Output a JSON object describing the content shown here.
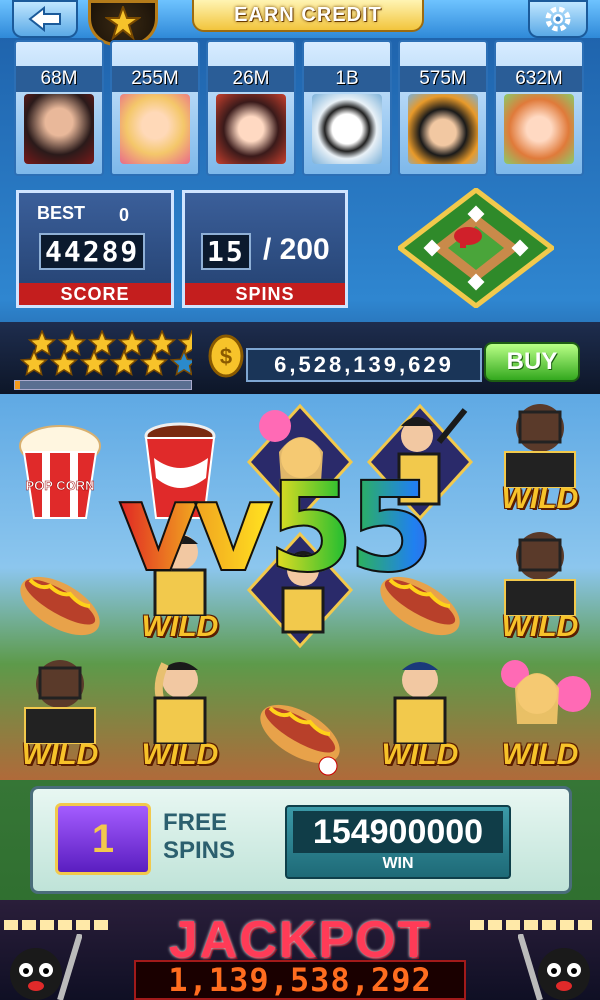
{
  "topbar": {
    "earn_credit_label": "EARN CREDIT"
  },
  "players": [
    {
      "score": "68M",
      "face_color": "#5b2a2a"
    },
    {
      "score": "255M",
      "face_color": "#f4c76a"
    },
    {
      "score": "26M",
      "face_color": "#c8402e"
    },
    {
      "score": "1B",
      "face_color": "#ffffff"
    },
    {
      "score": "575M",
      "face_color": "#e89a2a"
    },
    {
      "score": "632M",
      "face_color": "#e07a3a"
    }
  ],
  "score_panel": {
    "best_label": "BEST",
    "best_value": "0",
    "score_digits": "44289",
    "score_label": "SCORE"
  },
  "spins_panel": {
    "spins_done": "15",
    "spins_total": "/ 200",
    "spins_label": "SPINS"
  },
  "status": {
    "stars_filled": 11,
    "stars_total": 12,
    "xp_fraction": 0.03,
    "credits": "6,528,139,629",
    "buy_label": "BUY"
  },
  "reels": {
    "wild_label": "WILD",
    "popcorn_label": "POP CORN",
    "grid": [
      [
        "popcorn",
        "soda",
        "cheerleader",
        "batter",
        "catcher-wild"
      ],
      [
        "hotdog",
        "batter-wild",
        "batter",
        "hotdog",
        "catcher-wild"
      ],
      [
        "catcher-wild",
        "pitcher-wild",
        "hotdog",
        "pitcher-wild",
        "cheerleader-wild"
      ]
    ]
  },
  "watermark": "vv55",
  "free_spins": {
    "count": "1",
    "label_line1": "FREE",
    "label_line2": "SPINS",
    "win_value": "154900000",
    "win_label": "WIN"
  },
  "jackpot": {
    "title": "JACKPOT",
    "value": "1,139,538,292"
  }
}
